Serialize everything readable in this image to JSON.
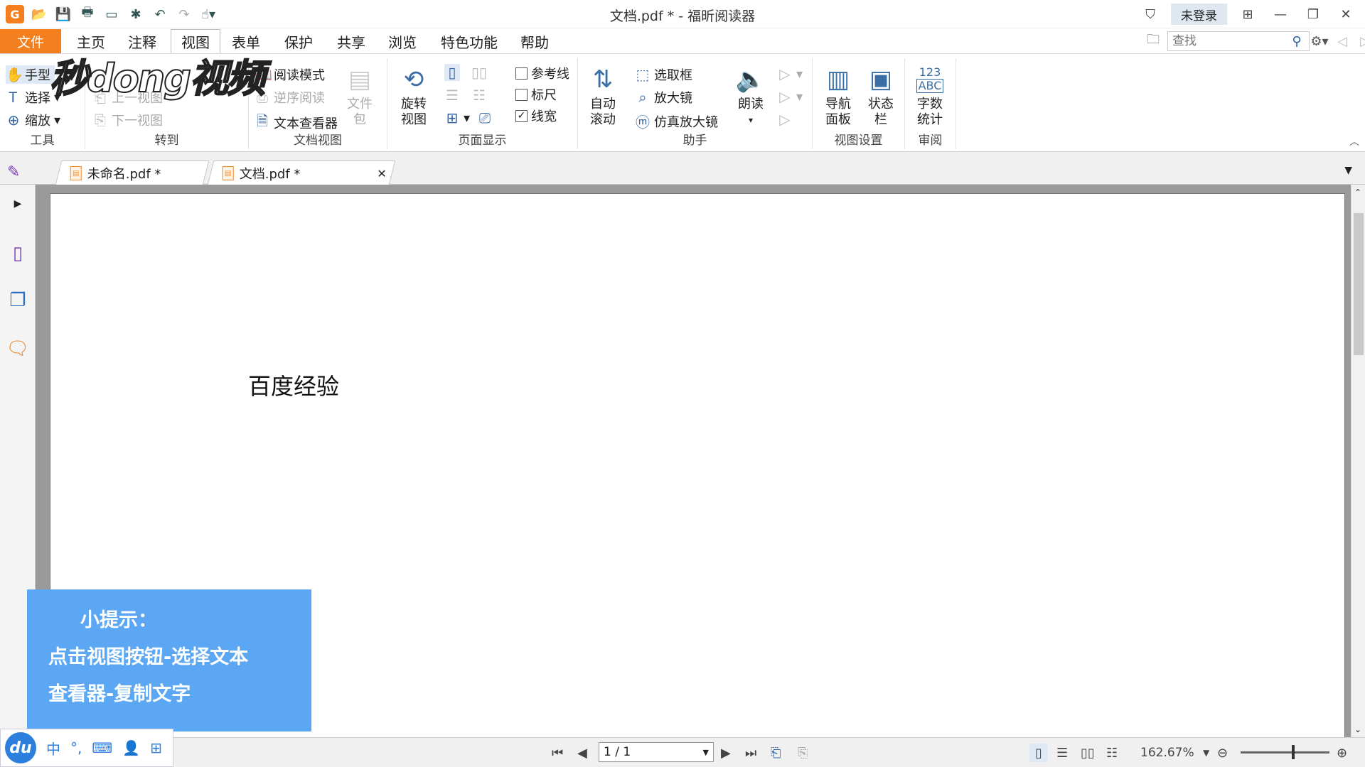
{
  "title_bar": {
    "title": "文档.pdf * - 福昕阅读器",
    "login_label": "未登录",
    "quick_access": [
      "app-logo",
      "open-icon",
      "save-icon",
      "print-icon",
      "screenshot-icon",
      "new-icon",
      "undo-icon",
      "redo-icon",
      "hand-dropdown-icon"
    ]
  },
  "menu": {
    "file": "文件",
    "tabs": [
      "主页",
      "注释",
      "视图",
      "表单",
      "保护",
      "共享",
      "浏览",
      "特色功能",
      "帮助"
    ],
    "active_tab": "视图",
    "search_placeholder": "查找"
  },
  "ribbon": {
    "tools": {
      "label": "工具",
      "hand": "手型",
      "select": "选择",
      "zoom": "缩放"
    },
    "goto": {
      "label": "转到",
      "prev_view": "上一视图",
      "next_view": "下一视图"
    },
    "doc_view": {
      "label": "文档视图",
      "read_mode": "阅读模式",
      "reverse_read": "逆序阅读",
      "text_viewer": "文本查看器",
      "portfolio": "文件包"
    },
    "page_display": {
      "label": "页面显示",
      "rotate": "旋转视图",
      "guides": "参考线",
      "ruler": "标尺",
      "line_weight": "线宽",
      "guides_checked": false,
      "ruler_checked": false,
      "line_weight_checked": true
    },
    "assistant": {
      "label": "助手",
      "auto_scroll": "自动滚动",
      "marquee": "选取框",
      "magnifier": "放大镜",
      "loupe": "仿真放大镜",
      "read_aloud": "朗读"
    },
    "view_settings": {
      "label": "视图设置",
      "nav_panel": "导航面板",
      "status_bar": "状态栏"
    },
    "review": {
      "label": "审阅",
      "word_count": "字数统计",
      "icon_text_top": "123",
      "icon_text_bottom": "ABC"
    }
  },
  "doc_tabs": [
    {
      "name": "未命名.pdf *"
    },
    {
      "name": "文档.pdf *"
    }
  ],
  "document": {
    "text": "百度经验"
  },
  "tip": {
    "line1": "小提示：",
    "line2": "点击视图按钮-选择文本",
    "line3": "查看器-复制文字"
  },
  "watermark": "秒dong视频",
  "status": {
    "page_value": "1 / 1",
    "zoom": "162.67%"
  },
  "ime": {
    "logo": "du",
    "lang": "中"
  }
}
